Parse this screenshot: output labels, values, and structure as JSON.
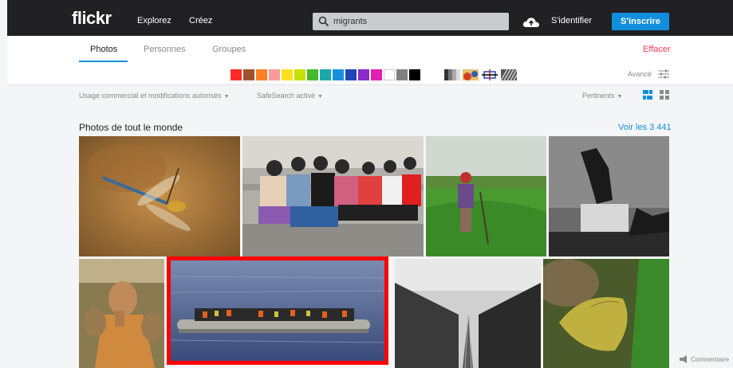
{
  "header": {
    "logo": "flickr",
    "nav": [
      "Explorez",
      "Créez"
    ],
    "search_value": "migrants",
    "signin": "S'identifier",
    "signup": "S'inscrire"
  },
  "tabs": [
    "Photos",
    "Personnes",
    "Groupes"
  ],
  "clear_label": "Effacer",
  "color_swatches": [
    "#ff2b2b",
    "#a0522d",
    "#ff7f27",
    "#ff9a9a",
    "#ffe020",
    "#c8e000",
    "#48b82c",
    "#1aa8a8",
    "#1890dc",
    "#2046b8",
    "#8a2cc8",
    "#e020b0",
    "#ffffff",
    "#808080",
    "#000000"
  ],
  "advanced_label": "Avancé",
  "filters": {
    "license": "Usage commercial et modifications autorisés",
    "safesearch": "SafeSearch activé",
    "sort": "Pertinents"
  },
  "section": {
    "title": "Photos de tout le monde",
    "see_all": "Voir les 3 441"
  },
  "footer": {
    "comment": "Commentaire"
  }
}
